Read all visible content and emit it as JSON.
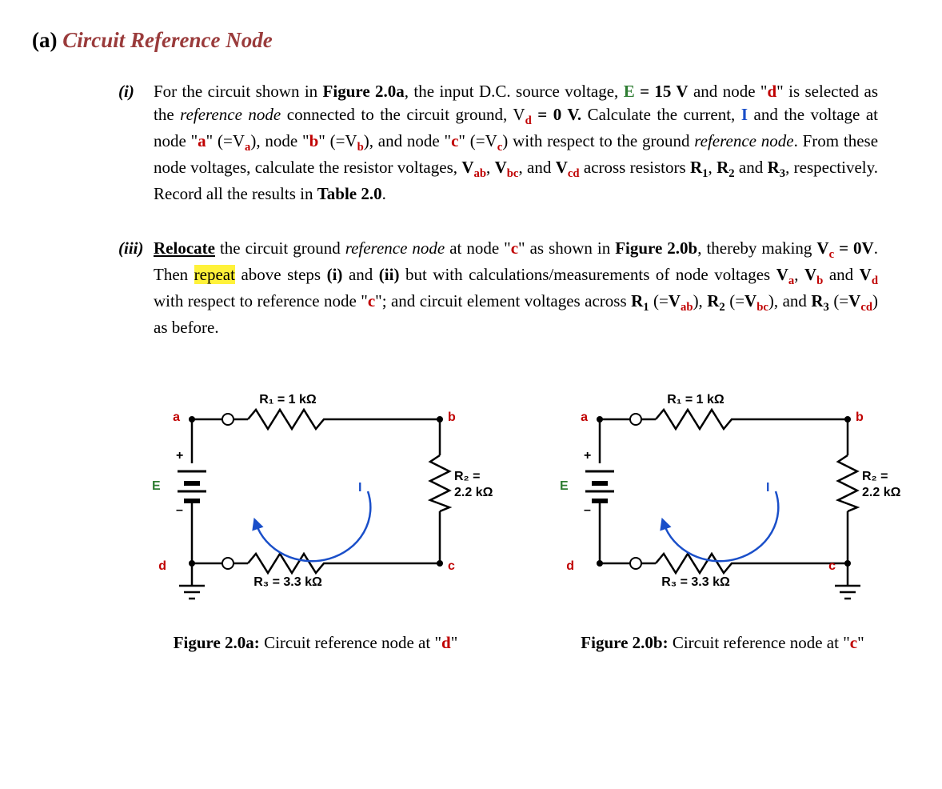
{
  "section": {
    "label": "(a)",
    "title": "Circuit Reference Node"
  },
  "p1": {
    "num": "(i)",
    "t1": "For the circuit shown in ",
    "fig_ref": "Figure 2.0a",
    "t2": ", the input D.C. source voltage, ",
    "E": "E",
    "E_eq": " = 15 V",
    "t3": " and node \"",
    "d": "d",
    "t4": "\" is selected as the ",
    "refnode": "reference node",
    "t5": " connected to the circuit ground, V",
    "d_sub": "d",
    "t6": " = 0 V.",
    "t7": " Calculate the current, ",
    "I": "I",
    "t8": " and the voltage at node \"",
    "a": "a",
    "t9": "\" (=V",
    "a_sub": "a",
    "t10": "), node \"",
    "b": "b",
    "t11": "\" (=V",
    "b_sub": "b",
    "t12": "), and node \"",
    "c": "c",
    "t13": "\" (=V",
    "c_sub": "c",
    "t14": ") with respect to the ground ",
    "refnode2": "reference node",
    "t15": ".  From these node voltages, calculate the resistor voltages, ",
    "Vab": "V",
    "ab_sub": "ab",
    "comma1": ", ",
    "Vbc": "V",
    "bc_sub": "bc",
    "comma2": ", and ",
    "Vcd": "V",
    "cd_sub": "cd",
    "t16": " across resistors ",
    "R1": "R",
    "r1_sub": "1",
    "comma3": ", ",
    "R2": "R",
    "r2_sub": "2",
    "and": " and ",
    "R3": "R",
    "r3_sub": "3",
    "t17": ", respectively.  Record all the results in ",
    "table_ref": "Table 2.0",
    "t18": "."
  },
  "p3": {
    "num": "(iii)",
    "relocate": "Relocate",
    "t1": " the circuit ground ",
    "refnode": "reference node",
    "t2": " at node \"",
    "c": "c",
    "t3": "\" as shown in ",
    "fig_ref": "Figure 2.0b",
    "t4": ", thereby making ",
    "Vc_pre": "V",
    "c_sub": "c",
    "Vc_eq": " = 0V",
    "t5": ". Then ",
    "repeat": "repeat",
    "t6": " above steps ",
    "step_i": "(i)",
    "and1": " and ",
    "step_ii": "(ii)",
    "t7": " but with calculations/measurements of node voltages ",
    "Va_pre": "V",
    "a_sub": "a",
    "c1": ", ",
    "Vb_pre": "V",
    "b_sub": "b",
    "and2": " and ",
    "Vd_pre": "V",
    "d_sub": "d",
    "t8": " with respect to reference node \"",
    "c2": "c",
    "t9": "\"; and circuit element voltages across ",
    "R1": "R",
    "r1_sub": "1",
    "p_open1": " (=",
    "Vab": "V",
    "ab_sub": "ab",
    "p_close1": "),  ",
    "R2": "R",
    "r2_sub": "2",
    "p_open2": " (=",
    "Vbc": "V",
    "bc_sub": "bc",
    "p_close2": "), and ",
    "R3": "R",
    "r3_sub": "3",
    "p_open3": " (=",
    "Vcd": "V",
    "cd_sub": "cd",
    "p_close3": ") as before."
  },
  "fig_a": {
    "E": "E",
    "plus": "+",
    "minus": "–",
    "R1": "R₁ = 1 kΩ",
    "R2a": "R₂ =",
    "R2b": "2.2 kΩ",
    "R3": "R₃ = 3.3 kΩ",
    "I": "I",
    "a": "a",
    "b": "b",
    "c": "c",
    "d": "d",
    "caption_b": "Figure 2.0a:",
    "caption_t1": " Circuit reference node at \"",
    "caption_node": "d",
    "caption_t2": "\""
  },
  "fig_b": {
    "E": "E",
    "plus": "+",
    "minus": "–",
    "R1": "R₁ = 1 kΩ",
    "R2a": "R₂ =",
    "R2b": "2.2 kΩ",
    "R3": "R₃ = 3.3 kΩ",
    "I": "I",
    "a": "a",
    "b": "b",
    "c": "c",
    "d": "d",
    "caption_b": "Figure 2.0b:",
    "caption_t1": " Circuit reference node at \"",
    "caption_node": "c",
    "caption_t2": "\""
  }
}
